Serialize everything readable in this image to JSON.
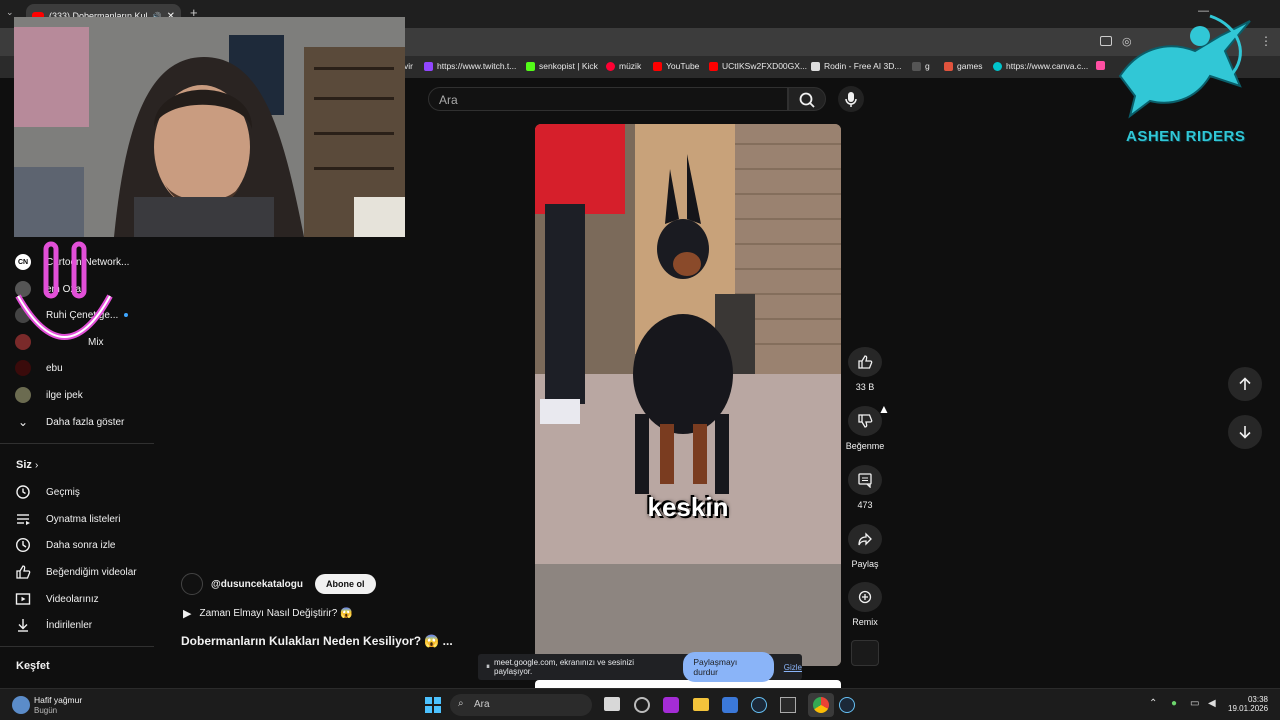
{
  "browser": {
    "tab_title": "(333) Dobermanların Kulakl",
    "bookmarks": [
      {
        "label": "https://www.twitch.t...",
        "color": "#9146ff"
      },
      {
        "label": "senkopist | Kick",
        "color": "#53fc18"
      },
      {
        "label": "müzik",
        "color": "#ff0033"
      },
      {
        "label": "YouTube",
        "color": "#ff0000"
      },
      {
        "label": "UCtIKSw2FXD00GX...",
        "color": "#ff0000"
      },
      {
        "label": "Rodin - Free AI 3D...",
        "color": "#dddddd"
      },
      {
        "label": "g",
        "color": "#888888"
      },
      {
        "label": "games",
        "color": "#e0533d"
      },
      {
        "label": "https://www.canva.c...",
        "color": "#00c4cc"
      }
    ],
    "bookmark_fragment": "vir"
  },
  "search": {
    "placeholder": "Ara"
  },
  "sidebar": {
    "subscriptions": [
      {
        "label": "Cartoon Network...",
        "visible": "Network..."
      },
      {
        "label": "em Ozan",
        "visible": "em Ozan"
      },
      {
        "label": "Ruhi Çenet ge...",
        "visible": "Ruhi Çenet...ge..."
      },
      {
        "label": "Mix",
        "visible": "Mix"
      },
      {
        "label": "ebu",
        "visible": "ebu"
      },
      {
        "label": "ilge ipek",
        "visible": "ilge ipek"
      }
    ],
    "show_more": "Daha fazla göster",
    "you_section": "Siz",
    "you_items": [
      "Geçmiş",
      "Oynatma listeleri",
      "Daha sonra izle",
      "Beğendiğim videolar",
      "Videolarınız",
      "İndirilenler"
    ],
    "explore_section": "Keşfet",
    "cartoon_prefix": "Cartoon"
  },
  "video": {
    "caption": "keskin",
    "channel": "@dusuncekatalogu",
    "subscribe": "Abone ol",
    "suggestion": "Zaman Elmayı Nasıl Değiştirir? 😱",
    "title": "Dobermanların Kulakları Neden Kesiliyor? 😱 ..."
  },
  "actions": {
    "likes": "33 B",
    "dislike": "Beğenme",
    "comments": "473",
    "share": "Paylaş",
    "remix": "Remix"
  },
  "share_bar": {
    "message": "meet.google.com, ekranınızı ve sesinizi paylaşıyor.",
    "stop": "Paylaşmayı durdur",
    "hide": "Gizle"
  },
  "overlay": {
    "logo_text": "ASHEN RIDERS"
  },
  "taskbar": {
    "weather_title": "Hafif yağmur",
    "weather_sub": "Bugün",
    "search": "Ara",
    "time": "03:38",
    "date": "19.01.2026"
  },
  "colors": {
    "accent": "#8ab4f8",
    "youtube_red": "#ff0000",
    "logo": "#31c7d6"
  }
}
